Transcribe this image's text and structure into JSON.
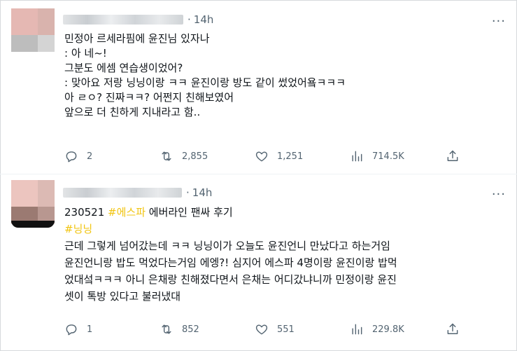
{
  "tweets": [
    {
      "time": "14h",
      "more": "···",
      "lines": [
        "민정아 르세라핌에 윤진님 있자나",
        ": 아 네~!",
        "그분도 에셈 연습생이었어?",
        ": 맞아요 저랑 닝닝이랑 ㅋㅋ 윤진이랑 방도 같이 썼었어욬ㅋㅋㅋ",
        "아 ㄹㅇ? 진짜ㅋㅋ? 어쩐지 친해보였어",
        "앞으로 더 친하게 지내라고 함.."
      ],
      "stats": {
        "replies": "2",
        "retweets": "2,855",
        "likes": "1,251",
        "views": "714.5K"
      }
    },
    {
      "time": "14h",
      "more": "···",
      "first_line": {
        "date": "230521",
        "hashtag": "#에스파",
        "rest": " 에버라인 팬싸 후기"
      },
      "hashtag_line": "#닝닝",
      "lines": [
        "근데 그렇게 넘어갔는데 ㅋㅋ 닝닝이가 오늘도 윤진언니 만났다고 하는거임",
        "윤진언니랑 밥도 먹었다는거임 에엥?! 심지어 에스파 4명이랑 윤진이랑 밥먹",
        "었대섴ㅋㅋㅋ 아니 은채랑 친해졌다면서 은채는 어디갔냐니까 민정이랑 윤진",
        "셋이 톡방 있다고 불러냈대"
      ],
      "stats": {
        "replies": "1",
        "retweets": "852",
        "likes": "551",
        "views": "229.8K"
      }
    }
  ],
  "colors": {
    "hashtag": "#f1c40f",
    "muted": "#536471",
    "text": "#0f1419"
  },
  "icons": [
    "reply-icon",
    "retweet-icon",
    "like-icon",
    "views-icon",
    "share-icon",
    "more-icon"
  ]
}
